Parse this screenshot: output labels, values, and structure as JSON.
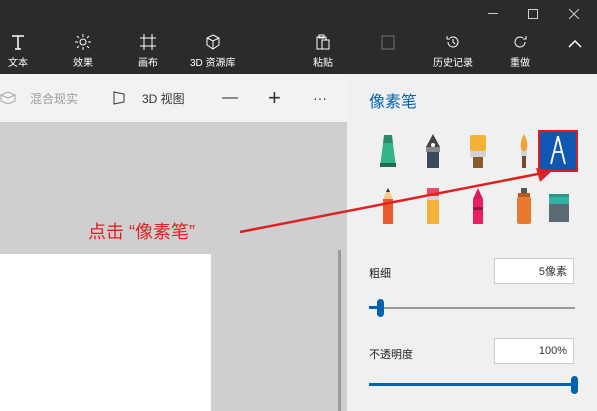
{
  "ribbon": {
    "text_label": "文本",
    "effects_label": "效果",
    "canvas_label": "画布",
    "library_label": "3D 资源库",
    "paste_label": "粘贴",
    "history_label": "历史记录",
    "redo_label": "重做"
  },
  "toolbar": {
    "mixed_reality_label": "混合现实",
    "view3d_label": "3D 视图",
    "zoom_out": "—",
    "zoom_in": "+",
    "more": "···"
  },
  "panel": {
    "title": "像素笔",
    "brushes_row1": [
      "marker-icon",
      "calligraphy-pen-icon",
      "oil-brush-icon",
      "watercolor-icon",
      "pixel-pen-icon"
    ],
    "brushes_row2": [
      "pencil-icon",
      "eraser-icon",
      "crayon-icon",
      "spray-can-icon",
      "fill-bucket-icon"
    ],
    "selected_brush": "pixel-pen-icon",
    "thickness_label": "粗细",
    "thickness_value": "5像素",
    "thickness_level": 0.04,
    "opacity_label": "不透明度",
    "opacity_value": "100%",
    "opacity_level": 1.0
  },
  "annotation": {
    "text": "点击 “像素笔”"
  },
  "colors": {
    "accent": "#0063b1",
    "annotation": "#e02020",
    "ribbon_bg": "#2b2b2b"
  }
}
